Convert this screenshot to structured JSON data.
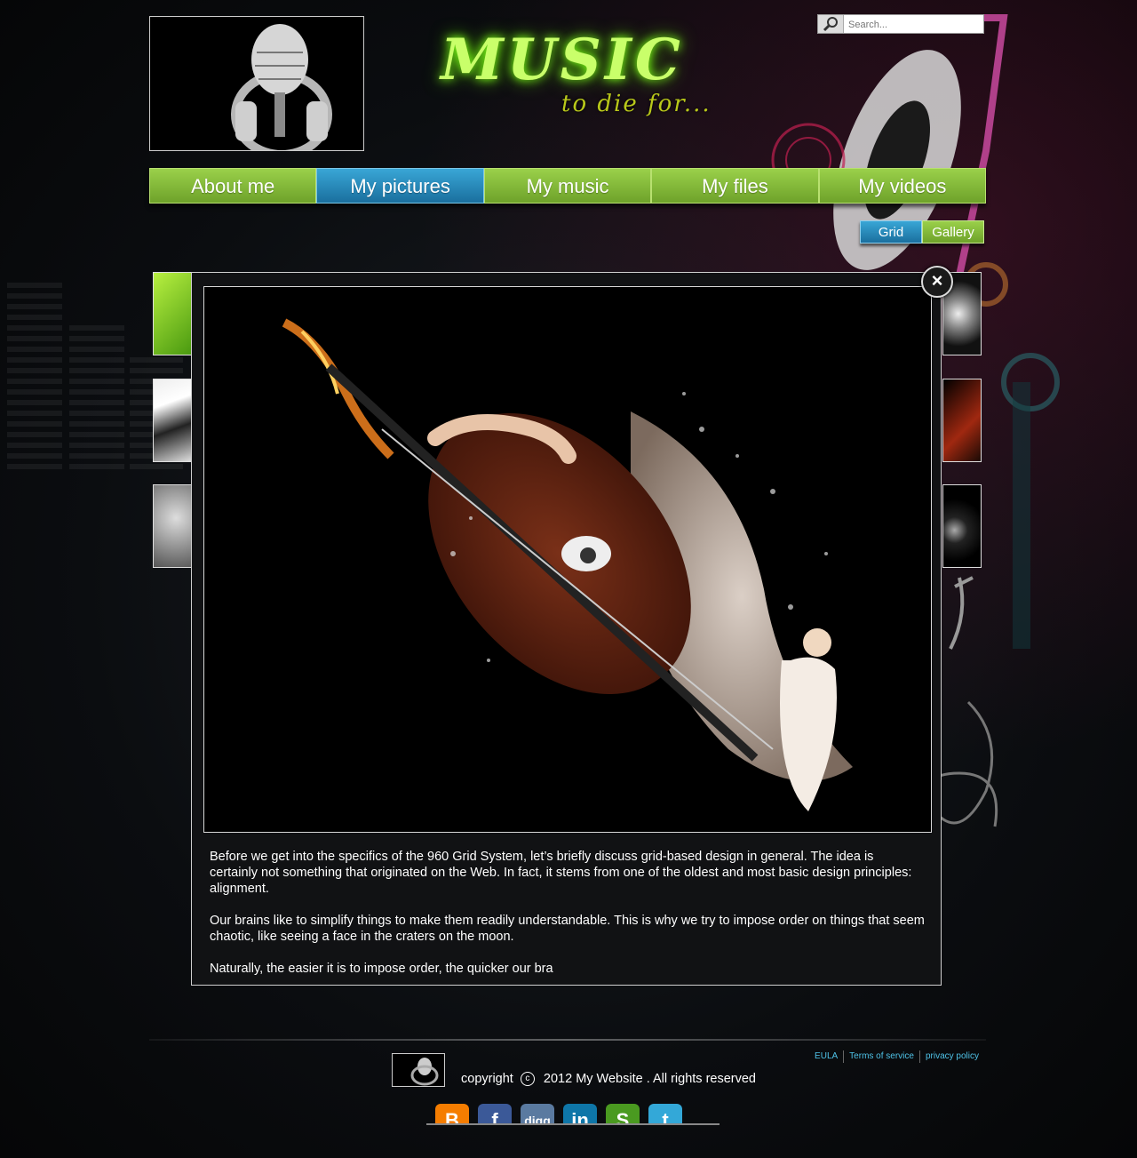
{
  "brand": {
    "title": "MUSIC",
    "tagline": "to die for..."
  },
  "search": {
    "placeholder": "Search..."
  },
  "nav": {
    "items": [
      {
        "label": "About me"
      },
      {
        "label": "My pictures",
        "active": true
      },
      {
        "label": "My music"
      },
      {
        "label": "My files"
      },
      {
        "label": "My videos"
      }
    ]
  },
  "view_toggle": {
    "grid_label": "Grid",
    "gallery_label": "Gallery",
    "active": "Grid"
  },
  "modal": {
    "close_label": "×",
    "paragraphs": [
      "Before we get into the specifics of the 960 Grid System, let’s briefly discuss grid-based design in general. The idea is certainly not something that originated on the Web. In fact, it stems from one of the oldest and most basic design principles: alignment.",
      "Our brains like to simplify things to make them readily understandable. This is why we try to impose order on things that seem chaotic, like seeing a face in the craters on the moon.",
      "Naturally, the easier it is to impose order, the quicker our bra"
    ]
  },
  "footer": {
    "copyright_prefix": "copyright",
    "copyright_symbol": "c",
    "copyright_text": "2012 My Website . All rights reserved",
    "links": [
      "EULA",
      "Terms of service",
      "privacy policy"
    ],
    "social_icons": [
      "blogger-icon",
      "facebook-icon",
      "digg-icon",
      "linkedin-icon",
      "stumbleupon-icon",
      "twitter-icon"
    ]
  },
  "colors": {
    "nav_green": "#7ab432",
    "nav_active_blue": "#2686b8",
    "link_blue": "#4fc3e8",
    "brand_glow": "#7dff1a"
  }
}
